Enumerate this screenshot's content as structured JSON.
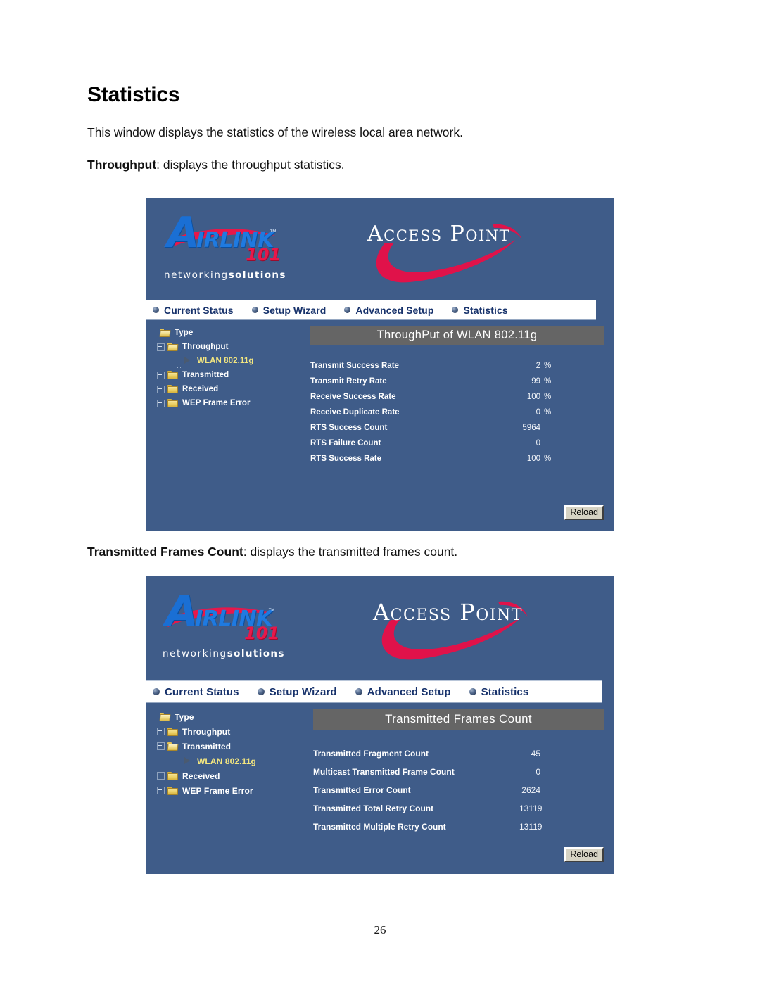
{
  "document": {
    "title": "Statistics",
    "intro": "This window displays the statistics of the wireless local area network.",
    "throughput_caption_bold": "Throughput",
    "throughput_caption_rest": ": displays the throughput statistics.",
    "frames_caption_bold": "Transmitted Frames Count",
    "frames_caption_rest": ": displays the transmitted frames count.",
    "page_number": "26"
  },
  "colors": {
    "panel_background": "#3f5c89",
    "pane_title_background": "#656565",
    "nav_background": "#ffffff",
    "nav_text": "#17326b",
    "logo_blue": "#1f7ae0",
    "logo_red": "#e8174a",
    "leaf_label": "#f3e67f",
    "button_face": "#d6d3c4"
  },
  "branding": {
    "logo_letter": "A",
    "logo_word": "IRLINK",
    "logo_number": "101",
    "logo_tm": "™",
    "tagline_light": "networking",
    "tagline_bold": "solutions",
    "product_title": "Access Point"
  },
  "nav": {
    "items": [
      {
        "label": "Current Status"
      },
      {
        "label": "Setup Wizard"
      },
      {
        "label": "Advanced Setup"
      },
      {
        "label": "Statistics"
      }
    ]
  },
  "panel_throughput": {
    "tree": {
      "root_label": "Type",
      "nodes": [
        {
          "label": "Throughput",
          "state": "expanded"
        },
        {
          "label": "WLAN 802.11g",
          "state": "leaf"
        },
        {
          "label": "Transmitted",
          "state": "collapsed"
        },
        {
          "label": "Received",
          "state": "collapsed"
        },
        {
          "label": "WEP Frame Error",
          "state": "collapsed"
        }
      ]
    },
    "pane_title": "ThroughPut of WLAN 802.11g",
    "rows": [
      {
        "label": "Transmit Success Rate",
        "value": "2",
        "unit": "%"
      },
      {
        "label": "Transmit Retry Rate",
        "value": "99",
        "unit": "%"
      },
      {
        "label": "Receive Success Rate",
        "value": "100",
        "unit": "%"
      },
      {
        "label": "Receive Duplicate Rate",
        "value": "0",
        "unit": "%"
      },
      {
        "label": "RTS Success Count",
        "value": "5964",
        "unit": ""
      },
      {
        "label": "RTS Failure Count",
        "value": "0",
        "unit": ""
      },
      {
        "label": "RTS Success Rate",
        "value": "100",
        "unit": "%"
      }
    ],
    "reload_label": "Reload"
  },
  "panel_frames": {
    "tree": {
      "root_label": "Type",
      "nodes": [
        {
          "label": "Throughput",
          "state": "collapsed"
        },
        {
          "label": "Transmitted",
          "state": "expanded"
        },
        {
          "label": "WLAN 802.11g",
          "state": "leaf"
        },
        {
          "label": "Received",
          "state": "collapsed"
        },
        {
          "label": "WEP Frame Error",
          "state": "collapsed"
        }
      ]
    },
    "pane_title": "Transmitted Frames Count",
    "rows": [
      {
        "label": "Transmitted Fragment Count",
        "value": "45",
        "unit": ""
      },
      {
        "label": "Multicast Transmitted Frame Count",
        "value": "0",
        "unit": ""
      },
      {
        "label": "Transmitted Error Count",
        "value": "2624",
        "unit": ""
      },
      {
        "label": "Transmitted Total Retry Count",
        "value": "13119",
        "unit": ""
      },
      {
        "label": "Transmitted Multiple Retry Count",
        "value": "13119",
        "unit": ""
      }
    ],
    "reload_label": "Reload"
  }
}
